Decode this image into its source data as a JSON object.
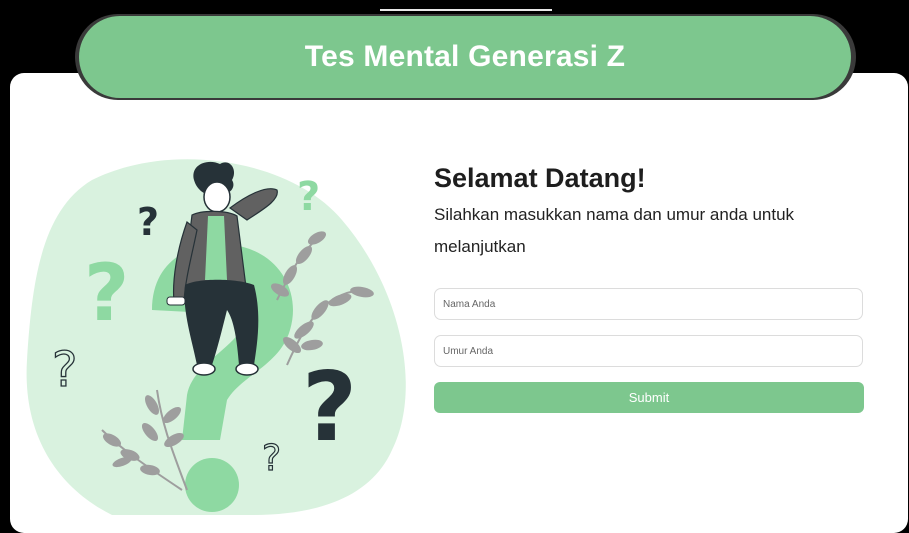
{
  "header": {
    "title": "Tes Mental Generasi Z"
  },
  "welcome": {
    "heading": "Selamat Datang!",
    "instruction": "Silahkan masukkan nama dan umur anda untuk melanjutkan"
  },
  "form": {
    "name_placeholder": "Nama Anda",
    "age_placeholder": "Umur Anda",
    "submit_label": "Submit"
  },
  "illustration": {
    "icon": "confused-person-question-marks-illustration",
    "question_mark": "?"
  },
  "colors": {
    "accent": "#7dc78e",
    "blob": "#d9f2df",
    "mark_green": "#8ed9a2",
    "dark": "#263238"
  }
}
